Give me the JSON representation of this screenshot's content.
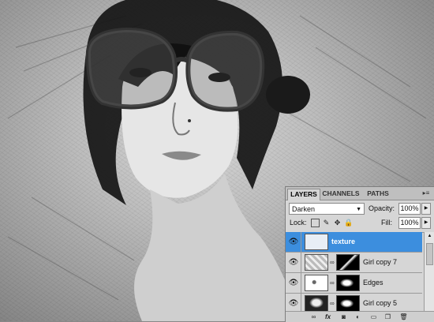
{
  "layers_panel": {
    "tabs": [
      {
        "label": "LAYERS"
      },
      {
        "label": "CHANNELS"
      },
      {
        "label": "PATHS"
      }
    ],
    "blend_mode": "Darken",
    "opacity_label": "Opacity:",
    "opacity_value": "100%",
    "lock_label": "Lock:",
    "fill_label": "Fill:",
    "fill_value": "100%",
    "layers": [
      {
        "name": "texture",
        "selected": true
      },
      {
        "name": "Girl copy 7",
        "selected": false
      },
      {
        "name": "Edges",
        "selected": false
      },
      {
        "name": "Girl copy 5",
        "selected": false
      }
    ],
    "footer_icons": [
      "link-icon",
      "fx-icon",
      "mask-icon",
      "adjustment-icon",
      "group-icon",
      "new-layer-icon",
      "trash-icon"
    ]
  },
  "colors": {
    "selected_layer": "#3c8ede",
    "panel_bg": "#d6d6d6"
  }
}
